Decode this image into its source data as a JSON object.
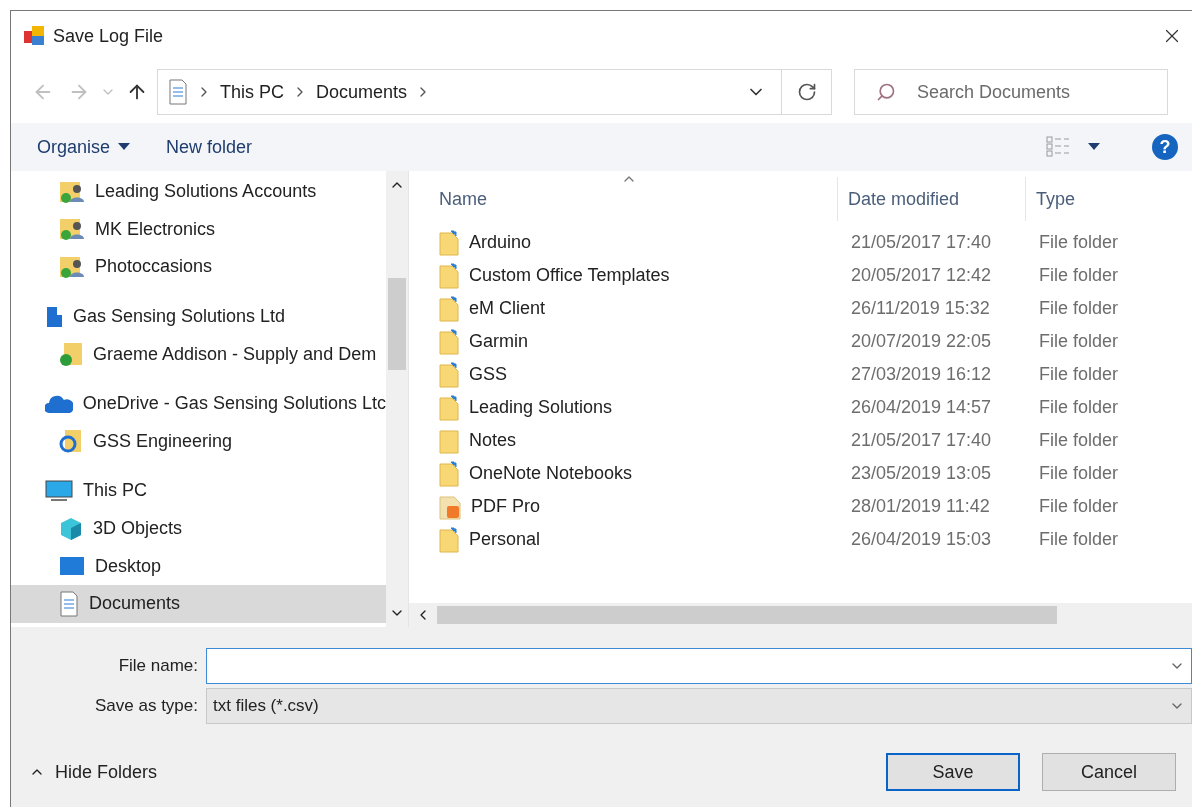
{
  "window": {
    "title": "Save Log File"
  },
  "address": {
    "crumbs": [
      "This PC",
      "Documents"
    ]
  },
  "search": {
    "placeholder": "Search Documents"
  },
  "toolbar": {
    "organise": "Organise",
    "new_folder": "New folder",
    "help": "?"
  },
  "sidebar": {
    "tree": [
      {
        "children": [
          {
            "label": "Leading Solutions Accounts",
            "kind": "shared"
          },
          {
            "label": "MK Electronics",
            "kind": "shared"
          },
          {
            "label": "Photoccasions",
            "kind": "shared"
          }
        ]
      },
      {
        "label": "Gas Sensing Solutions Ltd",
        "kind": "building",
        "children": [
          {
            "label": "Graeme Addison - Supply and Dem",
            "kind": "synced",
            "selected": false
          }
        ]
      },
      {
        "label": "OneDrive - Gas Sensing Solutions Ltc",
        "kind": "cloud",
        "children": [
          {
            "label": "GSS Engineering",
            "kind": "syncing"
          }
        ]
      },
      {
        "label": "This PC",
        "kind": "computer",
        "children": [
          {
            "label": "3D Objects",
            "kind": "cube",
            "selected": false
          },
          {
            "label": "Desktop",
            "kind": "desktop",
            "selected": false
          },
          {
            "label": "Documents",
            "kind": "documents",
            "selected": true
          }
        ]
      }
    ]
  },
  "table": {
    "columns": [
      "Name",
      "Date modified",
      "Type"
    ],
    "rows": [
      {
        "kind": "folder",
        "name": "Arduino",
        "date": "21/05/2017 17:40",
        "type": "File folder"
      },
      {
        "kind": "folder",
        "name": "Custom Office Templates",
        "date": "20/05/2017 12:42",
        "type": "File folder"
      },
      {
        "kind": "folder",
        "name": "eM Client",
        "date": "26/11/2019 15:32",
        "type": "File folder"
      },
      {
        "kind": "folder",
        "name": "Garmin",
        "date": "20/07/2019 22:05",
        "type": "File folder"
      },
      {
        "kind": "folder",
        "name": "GSS",
        "date": "27/03/2019 16:12",
        "type": "File folder"
      },
      {
        "kind": "folder",
        "name": "Leading Solutions",
        "date": "26/04/2019 14:57",
        "type": "File folder"
      },
      {
        "kind": "plain",
        "name": "Notes",
        "date": "21/05/2017 17:40",
        "type": "File folder"
      },
      {
        "kind": "folder",
        "name": "OneNote Notebooks",
        "date": "23/05/2019 13:05",
        "type": "File folder"
      },
      {
        "kind": "pdf",
        "name": "PDF Pro",
        "date": "28/01/2019 11:42",
        "type": "File folder"
      },
      {
        "kind": "folder",
        "name": "Personal",
        "date": "26/04/2019 15:03",
        "type": "File folder"
      }
    ]
  },
  "form": {
    "file_name_label": "File name:",
    "save_type_label": "Save as type:",
    "save_type_value": "txt files (*.csv)"
  },
  "footer": {
    "hide_folders": "Hide Folders",
    "save": "Save",
    "cancel": "Cancel"
  }
}
